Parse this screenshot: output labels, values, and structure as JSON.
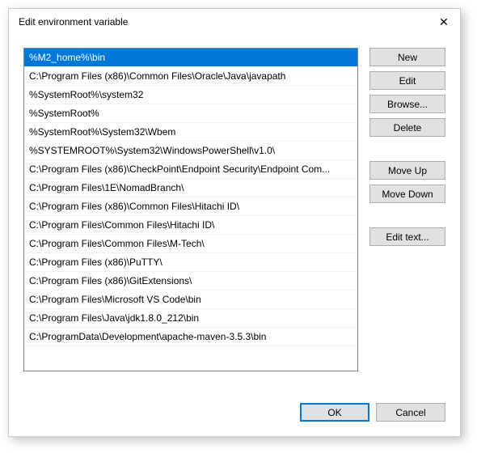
{
  "window": {
    "title": "Edit environment variable"
  },
  "list": {
    "selected_index": 0,
    "items": [
      "%M2_home%\\bin",
      "C:\\Program Files (x86)\\Common Files\\Oracle\\Java\\javapath",
      "%SystemRoot%\\system32",
      "%SystemRoot%",
      "%SystemRoot%\\System32\\Wbem",
      "%SYSTEMROOT%\\System32\\WindowsPowerShell\\v1.0\\",
      "C:\\Program Files (x86)\\CheckPoint\\Endpoint Security\\Endpoint Com...",
      "C:\\Program Files\\1E\\NomadBranch\\",
      "C:\\Program Files (x86)\\Common Files\\Hitachi ID\\",
      "C:\\Program Files\\Common Files\\Hitachi ID\\",
      "C:\\Program Files\\Common Files\\M-Tech\\",
      "C:\\Program Files (x86)\\PuTTY\\",
      "C:\\Program Files (x86)\\GitExtensions\\",
      "C:\\Program Files\\Microsoft VS Code\\bin",
      "C:\\Program Files\\Java\\jdk1.8.0_212\\bin",
      "C:\\ProgramData\\Development\\apache-maven-3.5.3\\bin"
    ]
  },
  "buttons": {
    "new": "New",
    "edit": "Edit",
    "browse": "Browse...",
    "delete": "Delete",
    "move_up": "Move Up",
    "move_down": "Move Down",
    "edit_text": "Edit text...",
    "ok": "OK",
    "cancel": "Cancel"
  }
}
